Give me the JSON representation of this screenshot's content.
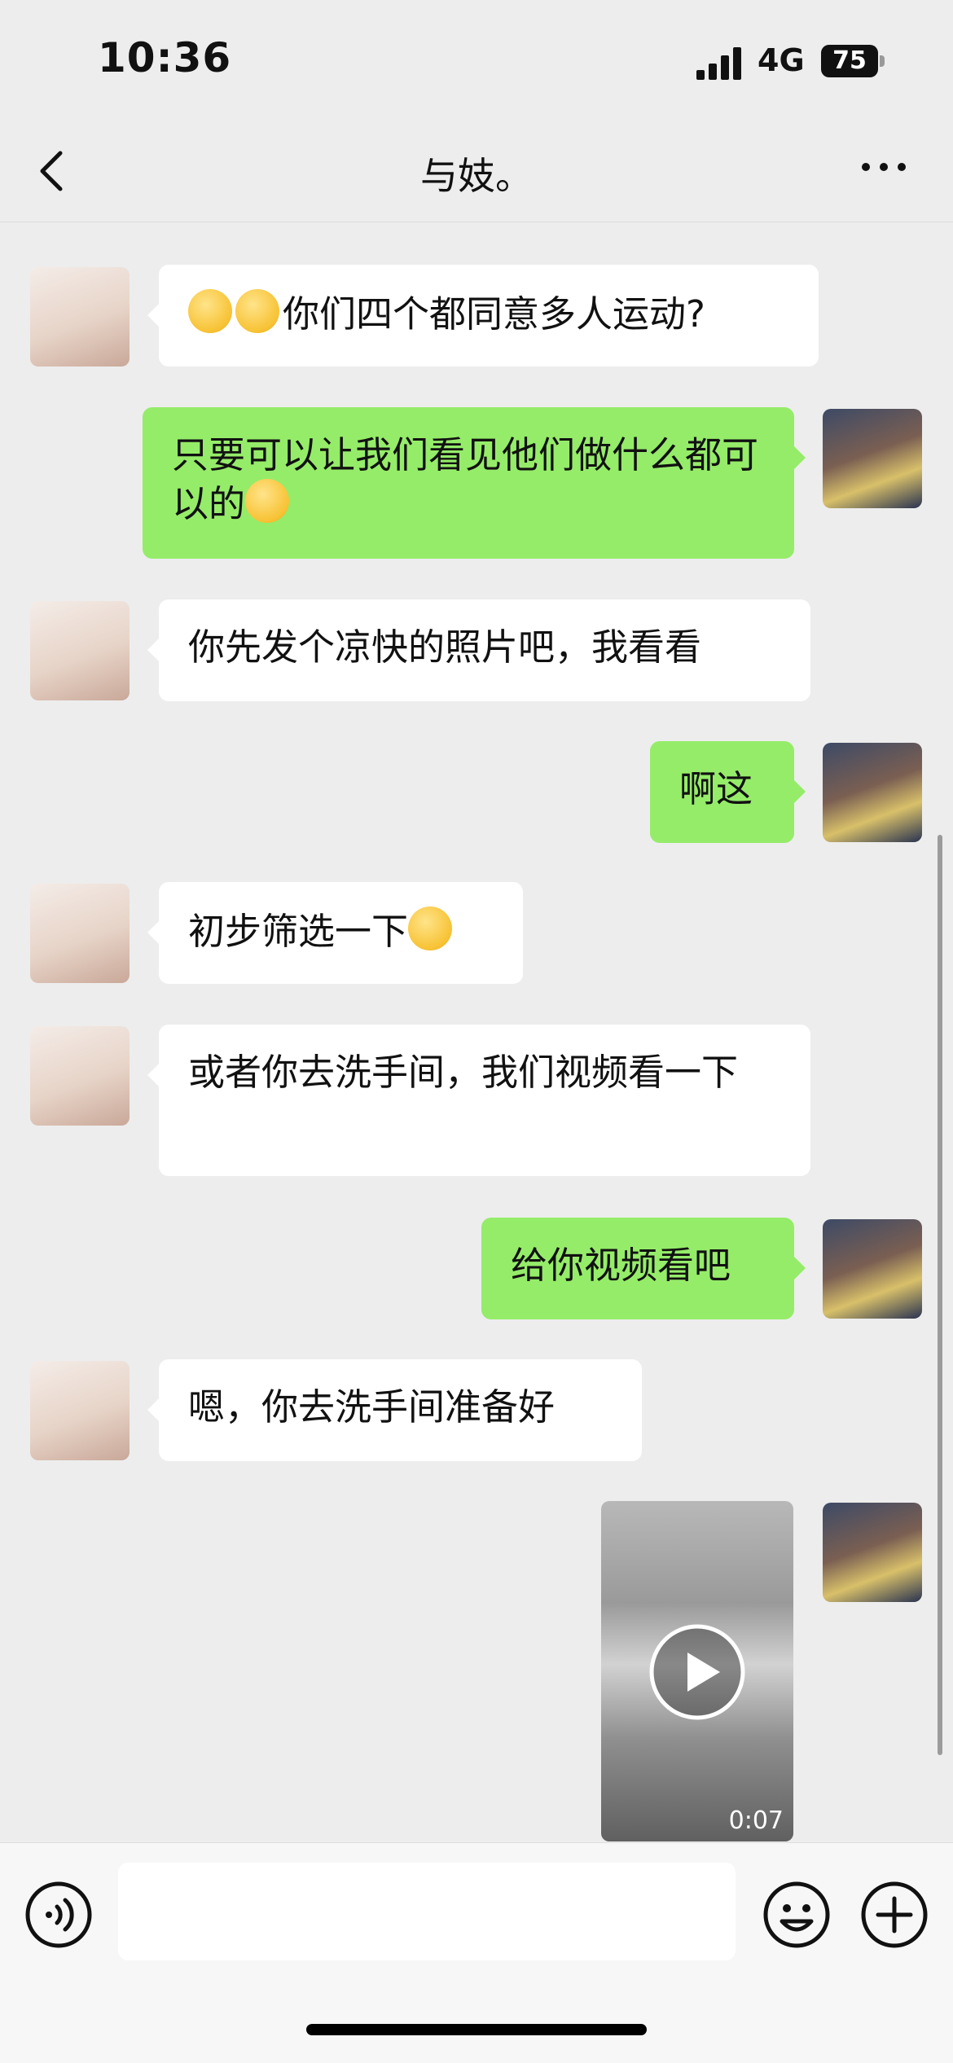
{
  "status_bar": {
    "time": "10:36",
    "network": "4G",
    "battery": "75"
  },
  "nav": {
    "title": "与妓。",
    "back_icon": "chevron-left-icon",
    "more_icon": "more-horizontal-icon"
  },
  "colors": {
    "background": "#ededed",
    "incoming_bubble": "#ffffff",
    "outgoing_bubble": "#95ec69",
    "input_bar": "#f7f7f7"
  },
  "messages": [
    {
      "sender": "other",
      "text": "你们四个都同意多人运动?",
      "emoji_before": [
        "crying-emoji",
        "crying-emoji"
      ]
    },
    {
      "sender": "me",
      "text": "只要可以让我们看见他们做什么都可以的",
      "emoji_after": [
        "pleading-emoji"
      ]
    },
    {
      "sender": "other",
      "text": "你先发个凉快的照片吧，我看看"
    },
    {
      "sender": "me",
      "text": "啊这"
    },
    {
      "sender": "other",
      "text": "初步筛选一下",
      "emoji_after": [
        "grinning-emoji"
      ]
    },
    {
      "sender": "other",
      "text": "或者你去洗手间，我们视频看一下"
    },
    {
      "sender": "me",
      "text": "给你视频看吧"
    },
    {
      "sender": "other",
      "text": "嗯，你去洗手间准备好"
    },
    {
      "sender": "me",
      "type": "video",
      "duration": "0:07",
      "icon": "play-icon"
    }
  ],
  "input": {
    "value": "",
    "voice_icon": "voice-icon",
    "emoji_icon": "smiley-icon",
    "more_icon": "plus-circle-icon"
  }
}
